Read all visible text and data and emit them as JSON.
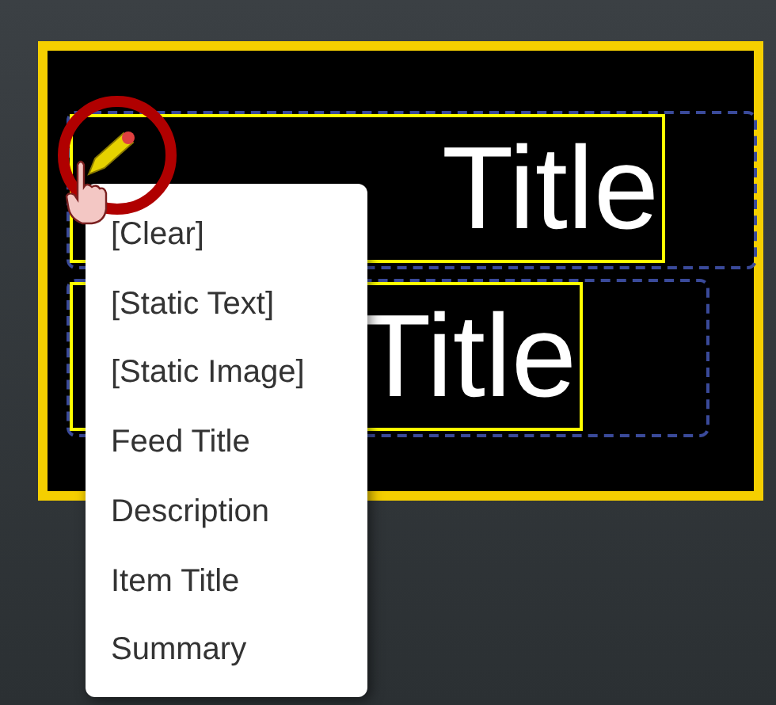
{
  "canvas": {
    "rows": [
      {
        "text": "Title"
      },
      {
        "text": "Title"
      }
    ]
  },
  "context_menu": {
    "items": [
      "[Clear]",
      "[Static Text]",
      "[Static Image]",
      "Feed Title",
      "Description",
      "Item Title",
      "Summary"
    ]
  }
}
